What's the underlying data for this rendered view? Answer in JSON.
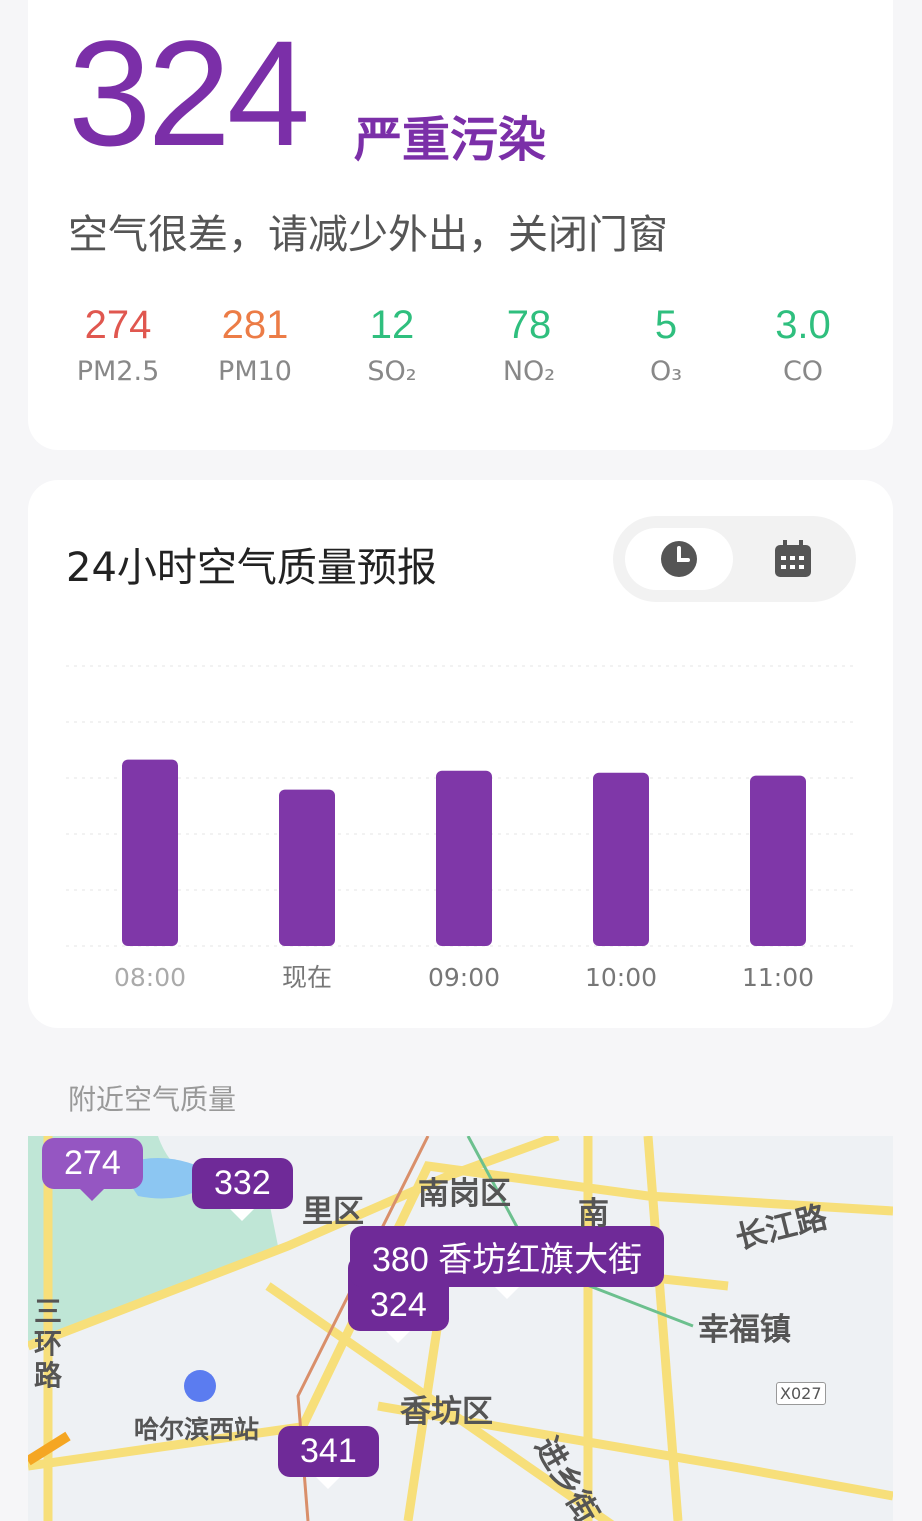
{
  "current": {
    "aqi": "324",
    "level": "严重污染",
    "advice": "空气很差，请减少外出，关闭门窗",
    "accent": "#7b2fa8"
  },
  "pollutants": [
    {
      "value": "274",
      "name": "PM2.5",
      "color": "#e0574f"
    },
    {
      "value": "281",
      "name": "PM10",
      "color": "#ec7c46"
    },
    {
      "value": "12",
      "name": "SO₂",
      "color": "#2fbf7e"
    },
    {
      "value": "78",
      "name": "NO₂",
      "color": "#2fbf7e"
    },
    {
      "value": "5",
      "name": "O₃",
      "color": "#2fbf7e"
    },
    {
      "value": "3.0",
      "name": "CO",
      "color": "#2fbf7e"
    }
  ],
  "forecast": {
    "title": "24小时空气质量预报",
    "toggle": [
      "clock-icon",
      "calendar-icon"
    ],
    "selected": "clock-icon"
  },
  "chart_data": {
    "type": "bar",
    "categories": [
      "08:00",
      "现在",
      "09:00",
      "10:00",
      "11:00"
    ],
    "values": [
      386,
      324,
      363,
      359,
      353
    ],
    "ylim": [
      0,
      580
    ],
    "grid": true,
    "bar_color": "#7f37a8"
  },
  "nearby": {
    "title": "附近空气质量",
    "markers": [
      {
        "text": "274"
      },
      {
        "text": "332"
      },
      {
        "text": "380 香坊红旗大街"
      },
      {
        "text": "324"
      },
      {
        "text": "341"
      }
    ],
    "labels": [
      "南岗区",
      "里区",
      "南",
      "长江路",
      "幸福镇",
      "三环路",
      "哈尔滨西站",
      "香坊区",
      "进乡街",
      "X027"
    ]
  }
}
